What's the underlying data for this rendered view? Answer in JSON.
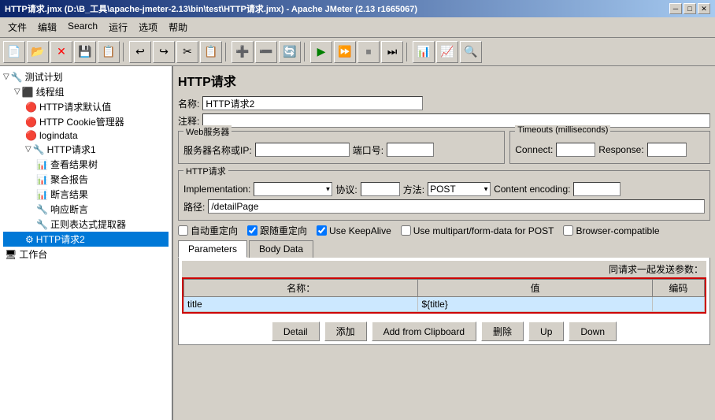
{
  "titleBar": {
    "text": "HTTP请求.jmx (D:\\B_工具\\apache-jmeter-2.13\\bin\\test\\HTTP请求.jmx) - Apache JMeter (2.13 r1665067)",
    "minBtn": "─",
    "maxBtn": "□",
    "closeBtn": "✕"
  },
  "menuBar": {
    "items": [
      "文件",
      "编辑",
      "Search",
      "运行",
      "选项",
      "帮助"
    ]
  },
  "toolbar": {
    "icons": [
      "📄",
      "💾",
      "❌",
      "💾",
      "📋",
      "↩",
      "↪",
      "✂",
      "📋",
      "➕",
      "➖",
      "🔄",
      "▶",
      "▶▶",
      "⏹",
      "⏭",
      "📊",
      "📊",
      "🔍"
    ]
  },
  "leftPanel": {
    "tree": [
      {
        "label": "测试计划",
        "level": 0,
        "icon": "🔧",
        "expand": "▽"
      },
      {
        "label": "线程组",
        "level": 1,
        "icon": "👥",
        "expand": "▽"
      },
      {
        "label": "HTTP请求默认值",
        "level": 2,
        "icon": "🔴"
      },
      {
        "label": "HTTP Cookie管理器",
        "level": 2,
        "icon": "🔴"
      },
      {
        "label": "logindata",
        "level": 2,
        "icon": "🔴"
      },
      {
        "label": "HTTP请求1",
        "level": 2,
        "icon": "⚙",
        "expand": "▽"
      },
      {
        "label": "查看结果树",
        "level": 3,
        "icon": "📊"
      },
      {
        "label": "聚合报告",
        "level": 3,
        "icon": "📊"
      },
      {
        "label": "断言结果",
        "level": 3,
        "icon": "📊"
      },
      {
        "label": "响应断言",
        "level": 3,
        "icon": "🔧"
      },
      {
        "label": "正则表达式提取器",
        "level": 3,
        "icon": "🔧"
      },
      {
        "label": "HTTP请求2",
        "level": 2,
        "icon": "⚙",
        "selected": true
      },
      {
        "label": "工作台",
        "level": 0,
        "icon": "🖥"
      }
    ]
  },
  "rightPanel": {
    "title": "HTTP请求",
    "nameLabel": "名称:",
    "nameValue": "HTTP请求2",
    "commentLabel": "注释:",
    "commentValue": "",
    "webServerGroup": "Web服务器",
    "serverLabel": "服务器名称或IP:",
    "serverValue": "",
    "portLabel": "端口号:",
    "portValue": "",
    "timeoutsGroup": "Timeouts (milliseconds)",
    "connectLabel": "Connect:",
    "connectValue": "",
    "responseLabel": "Response:",
    "responseValue": "",
    "httpRequestGroup": "HTTP请求",
    "implementationLabel": "Implementation:",
    "implementationValue": "",
    "protocolLabel": "协议:",
    "protocolValue": "",
    "methodLabel": "方法:",
    "methodValue": "POST",
    "encodingLabel": "Content encoding:",
    "encodingValue": "",
    "pathLabel": "路径:",
    "pathValue": "/detailPage",
    "checkboxes": {
      "autoRedirect": "自动重定向",
      "followRedirect": "跟随重定向",
      "keepAlive": "Use KeepAlive",
      "multipart": "Use multipart/form-data for POST",
      "browserCompat": "Browser-compatible"
    },
    "checkboxStates": {
      "autoRedirect": false,
      "followRedirect": true,
      "keepAlive": true,
      "multipart": false,
      "browserCompat": false
    },
    "tabs": [
      "Parameters",
      "Body Data"
    ],
    "activeTab": "Parameters",
    "sendParamsLabel": "同请求一起发送参数：",
    "tableHeaders": {
      "name": "名称：",
      "value": "值",
      "encode": "编码"
    },
    "tableRows": [
      {
        "name": "title",
        "value": "${title}",
        "encode": ""
      }
    ],
    "selectedRow": 0,
    "buttons": {
      "detail": "Detail",
      "add": "添加",
      "addFromClipboard": "Add from Clipboard",
      "delete": "删除",
      "up": "Up",
      "down": "Down"
    }
  }
}
